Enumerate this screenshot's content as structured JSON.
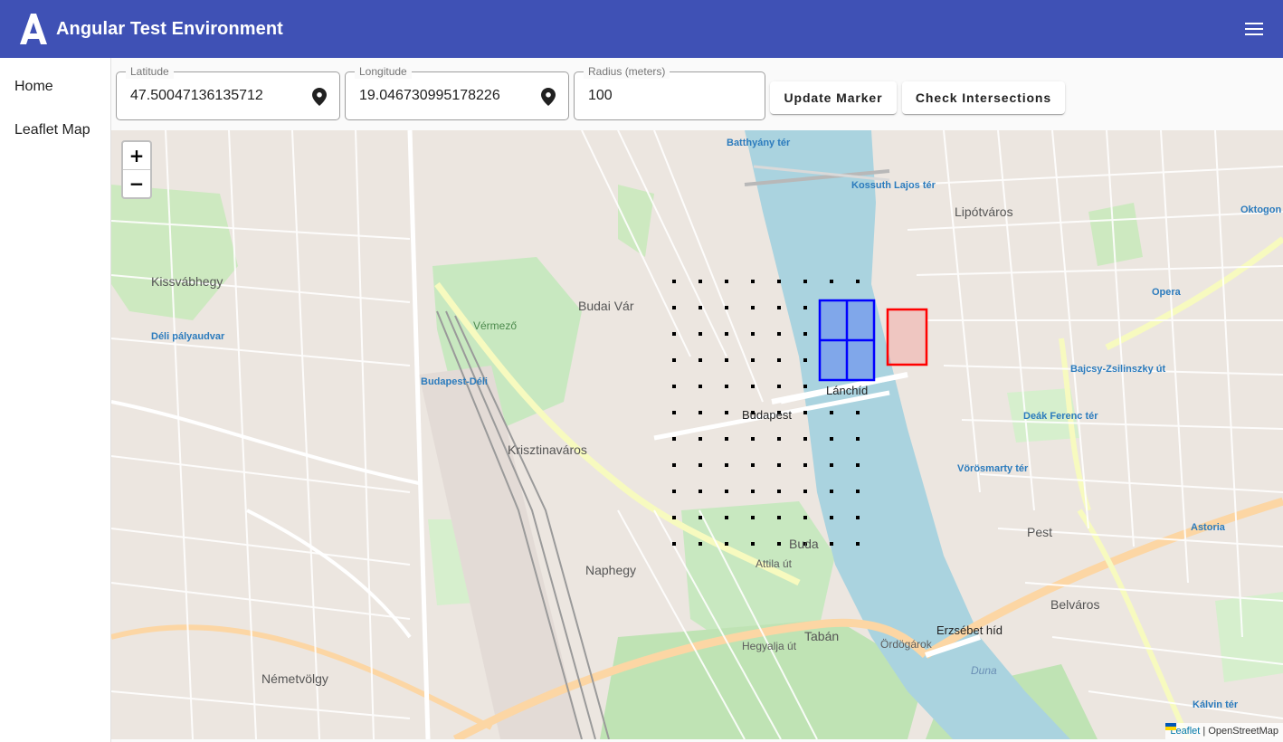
{
  "header": {
    "title": "Angular Test Environment",
    "logo_icon": "angular-logo-icon",
    "menu_icon": "hamburger-menu-icon",
    "background_color": "#3f51b5"
  },
  "sidenav": {
    "items": [
      {
        "label": "Home"
      },
      {
        "label": "Leaflet Map"
      }
    ]
  },
  "form": {
    "latitude": {
      "label": "Latitude",
      "value": "47.50047136135712",
      "icon": "location-pin-icon"
    },
    "longitude": {
      "label": "Longitude",
      "value": "19.046730995178226",
      "icon": "location-pin-icon"
    },
    "radius": {
      "label": "Radius (meters)",
      "value": "100"
    },
    "update_label": "Update Marker",
    "check_label": "Check Intersections"
  },
  "map": {
    "zoom_in": "+",
    "zoom_out": "−",
    "attribution": {
      "leaflet": "Leaflet",
      "separator": "|",
      "osm": "OpenStreetMap"
    },
    "labels": {
      "budapest": "Budapest",
      "kissvabhegy": "Kissvábhegy",
      "budai_var": "Budai Vár",
      "krisztinavaros": "Krisztinaváros",
      "naphegy": "Naphegy",
      "buda": "Buda",
      "taban": "Tabán",
      "nemetvolgy": "Németvölgy",
      "lipotvaros": "Lipótváros",
      "belvaros": "Belváros",
      "pest": "Pest",
      "erzsebet_hid": "Erzsébet híd",
      "lanchid": "Lánchíd",
      "deli_palyaudvar": "Déli pályaudvar",
      "budapest_deli": "Budapest-Déli",
      "batthyany_ter": "Batthyány tér",
      "kossuth_ter": "Kossuth Lajos tér",
      "deak_ferenc_ter": "Deák Ferenc tér",
      "vorosmarty_ter": "Vörösmarty tér",
      "bajcsy": "Bajcsy-Zsilinszky út",
      "astoria": "Astoria",
      "kalvin_ter": "Kálvin tér",
      "oktogon": "Oktogon",
      "opera": "Opera",
      "ordogarok": "Ördögárok",
      "duna": "Duna",
      "attila_ut": "Attila út",
      "hegyalja_ut": "Hegyalja út",
      "vermezo": "Vérmező"
    },
    "colors": {
      "water": "#aad3df",
      "park": "#c8facc",
      "marker_grid": "#0000ff",
      "check_box": "#ff0000",
      "dots": "#000000"
    }
  }
}
